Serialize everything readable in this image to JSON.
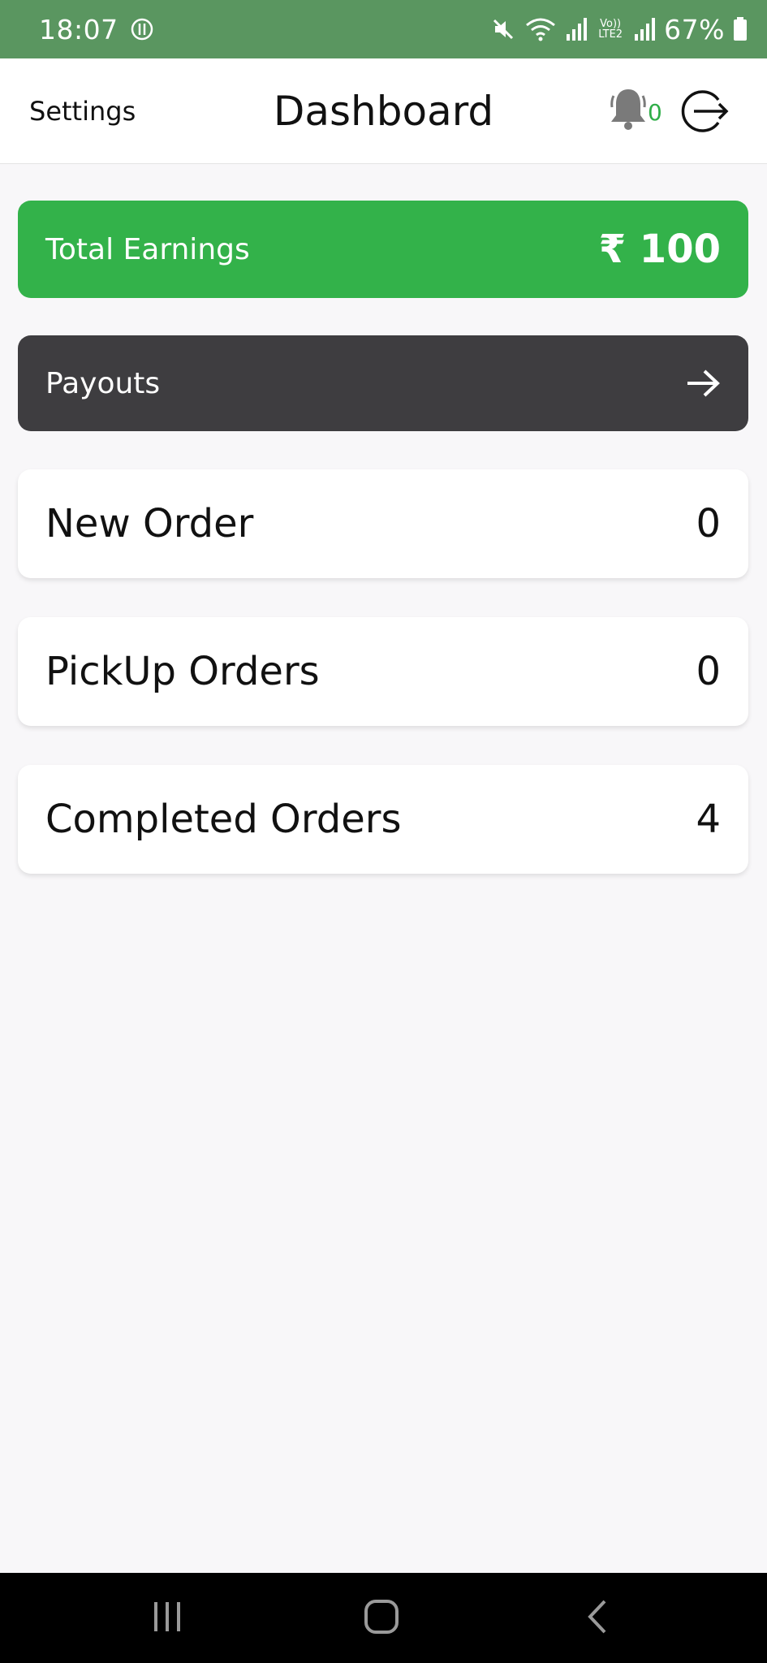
{
  "status_bar": {
    "time": "18:07",
    "battery": "67%",
    "network_label": "Vo)) LTE2"
  },
  "header": {
    "settings_label": "Settings",
    "title": "Dashboard",
    "notification_count": "0"
  },
  "earnings": {
    "label": "Total Earnings",
    "value": "₹ 100"
  },
  "payouts": {
    "label": "Payouts"
  },
  "orders": {
    "new_label": "New Order",
    "new_count": "0",
    "pickup_label": "PickUp Orders",
    "pickup_count": "0",
    "completed_label": "Completed Orders",
    "completed_count": "4"
  },
  "colors": {
    "status_bar": "#5a9660",
    "accent_green": "#33b24a",
    "payouts_dark": "#3e3d40",
    "background": "#f8f7f9"
  },
  "icons": {
    "status": [
      "alarm-icon",
      "mute-icon",
      "wifi-icon",
      "signal-icon",
      "battery-icon"
    ],
    "header": [
      "bell-icon",
      "logout-icon"
    ],
    "payouts": "arrow-right-icon",
    "nav": [
      "recents-icon",
      "home-icon",
      "back-icon"
    ]
  }
}
